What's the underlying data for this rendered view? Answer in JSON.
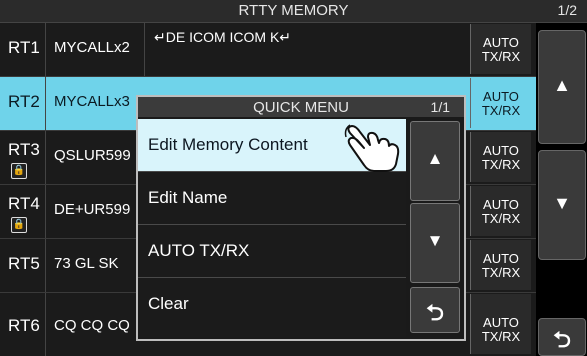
{
  "header": {
    "title": "RTTY MEMORY",
    "page": "1/2"
  },
  "rows": [
    {
      "num": "RT1",
      "name": "MYCALLx2",
      "content": "↵DE ICOM ICOM K↵",
      "auto_top": "AUTO",
      "auto_bottom": "TX/RX"
    },
    {
      "num": "RT2",
      "name": "MYCALLx3",
      "content": "",
      "auto_top": "AUTO",
      "auto_bottom": "TX/RX"
    },
    {
      "num": "RT3",
      "name": "QSLUR599",
      "content": "",
      "auto_top": "AUTO",
      "auto_bottom": "TX/RX"
    },
    {
      "num": "RT4",
      "name": "DE+UR599",
      "content": "",
      "auto_top": "AUTO",
      "auto_bottom": "TX/RX"
    },
    {
      "num": "RT5",
      "name": "73 GL SK",
      "content": "",
      "auto_top": "AUTO",
      "auto_bottom": "TX/RX"
    },
    {
      "num": "RT6",
      "name": "CQ CQ CQ",
      "content": "",
      "auto_top": "AUTO",
      "auto_bottom": "TX/RX"
    }
  ],
  "side_buttons": {
    "up_icon": "triangle-up",
    "down_icon": "triangle-down",
    "back_icon": "return-arrow"
  },
  "quick_menu": {
    "title": "QUICK MENU",
    "page": "1/1",
    "items": [
      {
        "label": "Edit Memory Content"
      },
      {
        "label": "Edit Name"
      },
      {
        "label": "AUTO TX/RX"
      },
      {
        "label": "Clear"
      }
    ]
  },
  "colors": {
    "selected_row": "#6fd3ea",
    "selected_menu_item": "#d9f4fb",
    "background": "#000000"
  }
}
